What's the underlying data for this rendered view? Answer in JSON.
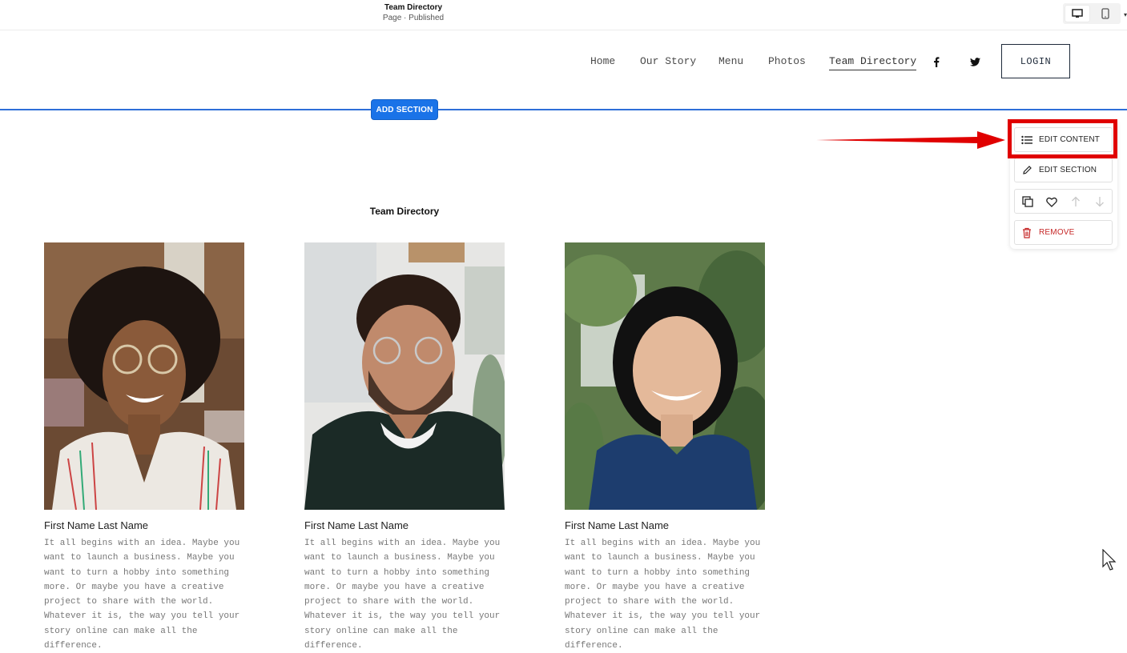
{
  "editor": {
    "page_title": "Team Directory",
    "page_status": "Page · Published"
  },
  "nav": {
    "links": [
      "Home",
      "Our Story",
      "Menu",
      "Photos",
      "Team Directory"
    ],
    "active": "Team Directory",
    "social": [
      "facebook-icon",
      "twitter-icon"
    ],
    "login_label": "LOGIN"
  },
  "add_section_label": "ADD SECTION",
  "section": {
    "title": "Team Directory",
    "members": [
      {
        "name": "First Name Last Name",
        "bio": "It all begins with an idea. Maybe you want to launch a business. Maybe you want to turn a hobby into something more. Or maybe you have a creative project to share with the world. Whatever it is, the way you tell your story online can make all the difference."
      },
      {
        "name": "First Name Last Name",
        "bio": "It all begins with an idea. Maybe you want to launch a business. Maybe you want to turn a hobby into something more. Or maybe you have a creative project to share with the world. Whatever it is, the way you tell your story online can make all the difference."
      },
      {
        "name": "First Name Last Name",
        "bio": "It all begins with an idea. Maybe you want to launch a business. Maybe you want to turn a hobby into something more. Or maybe you have a creative project to share with the world. Whatever it is, the way you tell your story online can make all the difference."
      }
    ]
  },
  "menu": {
    "edit_content": "EDIT CONTENT",
    "edit_section": "EDIT SECTION",
    "remove": "REMOVE",
    "icon_row": [
      "duplicate-icon",
      "heart-icon",
      "arrow-up-icon",
      "arrow-down-icon"
    ]
  },
  "colors": {
    "accent_blue": "#1a73e8",
    "highlight_red": "#e00000",
    "remove_red": "#c62828"
  }
}
